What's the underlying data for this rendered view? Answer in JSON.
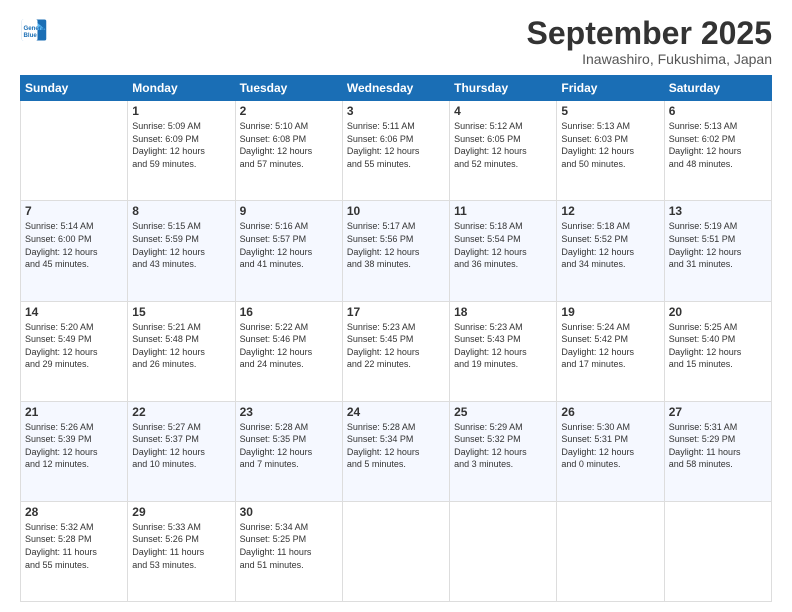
{
  "logo": {
    "line1": "General",
    "line2": "Blue"
  },
  "header": {
    "month": "September 2025",
    "location": "Inawashiro, Fukushima, Japan"
  },
  "weekdays": [
    "Sunday",
    "Monday",
    "Tuesday",
    "Wednesday",
    "Thursday",
    "Friday",
    "Saturday"
  ],
  "weeks": [
    [
      {
        "day": "",
        "info": ""
      },
      {
        "day": "1",
        "info": "Sunrise: 5:09 AM\nSunset: 6:09 PM\nDaylight: 12 hours\nand 59 minutes."
      },
      {
        "day": "2",
        "info": "Sunrise: 5:10 AM\nSunset: 6:08 PM\nDaylight: 12 hours\nand 57 minutes."
      },
      {
        "day": "3",
        "info": "Sunrise: 5:11 AM\nSunset: 6:06 PM\nDaylight: 12 hours\nand 55 minutes."
      },
      {
        "day": "4",
        "info": "Sunrise: 5:12 AM\nSunset: 6:05 PM\nDaylight: 12 hours\nand 52 minutes."
      },
      {
        "day": "5",
        "info": "Sunrise: 5:13 AM\nSunset: 6:03 PM\nDaylight: 12 hours\nand 50 minutes."
      },
      {
        "day": "6",
        "info": "Sunrise: 5:13 AM\nSunset: 6:02 PM\nDaylight: 12 hours\nand 48 minutes."
      }
    ],
    [
      {
        "day": "7",
        "info": "Sunrise: 5:14 AM\nSunset: 6:00 PM\nDaylight: 12 hours\nand 45 minutes."
      },
      {
        "day": "8",
        "info": "Sunrise: 5:15 AM\nSunset: 5:59 PM\nDaylight: 12 hours\nand 43 minutes."
      },
      {
        "day": "9",
        "info": "Sunrise: 5:16 AM\nSunset: 5:57 PM\nDaylight: 12 hours\nand 41 minutes."
      },
      {
        "day": "10",
        "info": "Sunrise: 5:17 AM\nSunset: 5:56 PM\nDaylight: 12 hours\nand 38 minutes."
      },
      {
        "day": "11",
        "info": "Sunrise: 5:18 AM\nSunset: 5:54 PM\nDaylight: 12 hours\nand 36 minutes."
      },
      {
        "day": "12",
        "info": "Sunrise: 5:18 AM\nSunset: 5:52 PM\nDaylight: 12 hours\nand 34 minutes."
      },
      {
        "day": "13",
        "info": "Sunrise: 5:19 AM\nSunset: 5:51 PM\nDaylight: 12 hours\nand 31 minutes."
      }
    ],
    [
      {
        "day": "14",
        "info": "Sunrise: 5:20 AM\nSunset: 5:49 PM\nDaylight: 12 hours\nand 29 minutes."
      },
      {
        "day": "15",
        "info": "Sunrise: 5:21 AM\nSunset: 5:48 PM\nDaylight: 12 hours\nand 26 minutes."
      },
      {
        "day": "16",
        "info": "Sunrise: 5:22 AM\nSunset: 5:46 PM\nDaylight: 12 hours\nand 24 minutes."
      },
      {
        "day": "17",
        "info": "Sunrise: 5:23 AM\nSunset: 5:45 PM\nDaylight: 12 hours\nand 22 minutes."
      },
      {
        "day": "18",
        "info": "Sunrise: 5:23 AM\nSunset: 5:43 PM\nDaylight: 12 hours\nand 19 minutes."
      },
      {
        "day": "19",
        "info": "Sunrise: 5:24 AM\nSunset: 5:42 PM\nDaylight: 12 hours\nand 17 minutes."
      },
      {
        "day": "20",
        "info": "Sunrise: 5:25 AM\nSunset: 5:40 PM\nDaylight: 12 hours\nand 15 minutes."
      }
    ],
    [
      {
        "day": "21",
        "info": "Sunrise: 5:26 AM\nSunset: 5:39 PM\nDaylight: 12 hours\nand 12 minutes."
      },
      {
        "day": "22",
        "info": "Sunrise: 5:27 AM\nSunset: 5:37 PM\nDaylight: 12 hours\nand 10 minutes."
      },
      {
        "day": "23",
        "info": "Sunrise: 5:28 AM\nSunset: 5:35 PM\nDaylight: 12 hours\nand 7 minutes."
      },
      {
        "day": "24",
        "info": "Sunrise: 5:28 AM\nSunset: 5:34 PM\nDaylight: 12 hours\nand 5 minutes."
      },
      {
        "day": "25",
        "info": "Sunrise: 5:29 AM\nSunset: 5:32 PM\nDaylight: 12 hours\nand 3 minutes."
      },
      {
        "day": "26",
        "info": "Sunrise: 5:30 AM\nSunset: 5:31 PM\nDaylight: 12 hours\nand 0 minutes."
      },
      {
        "day": "27",
        "info": "Sunrise: 5:31 AM\nSunset: 5:29 PM\nDaylight: 11 hours\nand 58 minutes."
      }
    ],
    [
      {
        "day": "28",
        "info": "Sunrise: 5:32 AM\nSunset: 5:28 PM\nDaylight: 11 hours\nand 55 minutes."
      },
      {
        "day": "29",
        "info": "Sunrise: 5:33 AM\nSunset: 5:26 PM\nDaylight: 11 hours\nand 53 minutes."
      },
      {
        "day": "30",
        "info": "Sunrise: 5:34 AM\nSunset: 5:25 PM\nDaylight: 11 hours\nand 51 minutes."
      },
      {
        "day": "",
        "info": ""
      },
      {
        "day": "",
        "info": ""
      },
      {
        "day": "",
        "info": ""
      },
      {
        "day": "",
        "info": ""
      }
    ]
  ]
}
